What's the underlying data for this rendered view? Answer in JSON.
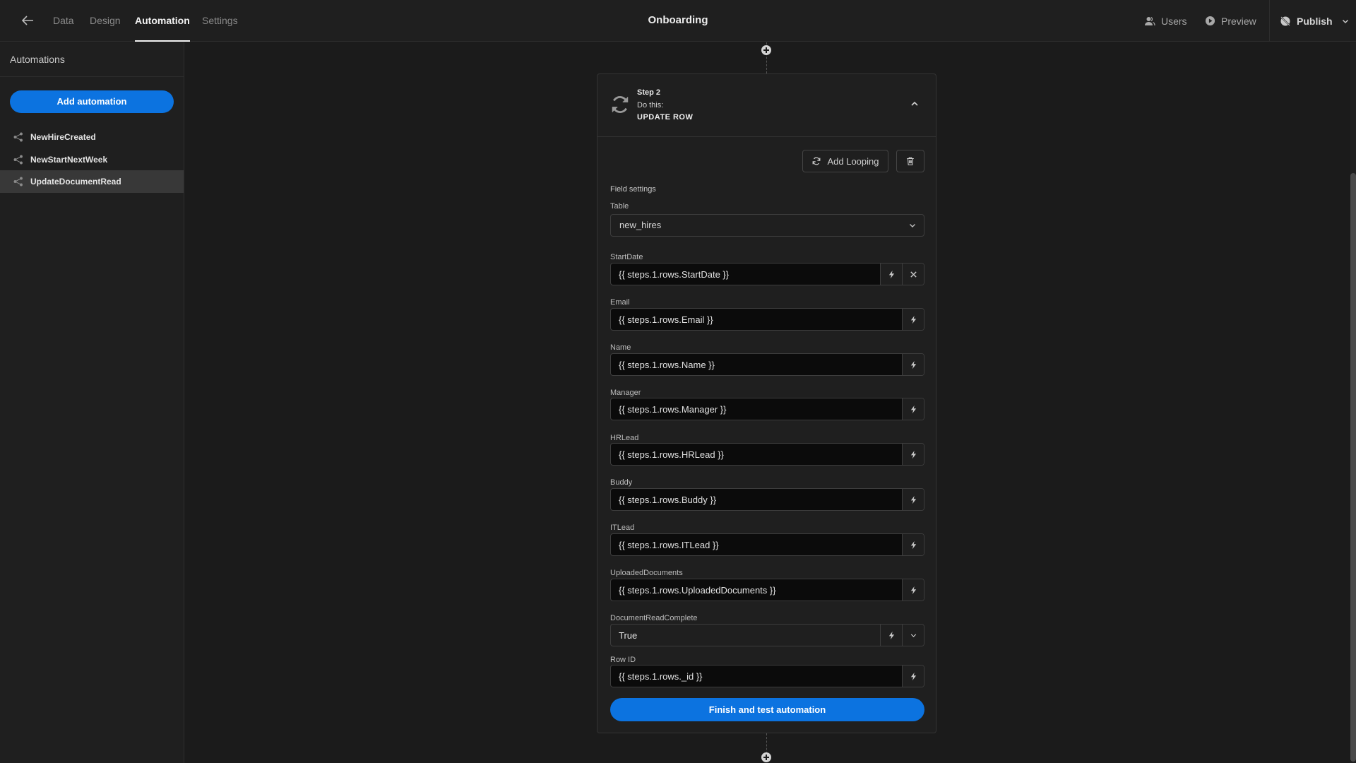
{
  "topbar": {
    "tabs": [
      {
        "label": "Data",
        "active": false
      },
      {
        "label": "Design",
        "active": false
      },
      {
        "label": "Automation",
        "active": true
      },
      {
        "label": "Settings",
        "active": false
      }
    ],
    "title": "Onboarding",
    "users_label": "Users",
    "preview_label": "Preview",
    "publish_label": "Publish"
  },
  "sidebar": {
    "title": "Automations",
    "add_button": "Add automation",
    "items": [
      {
        "label": "NewHireCreated",
        "selected": false
      },
      {
        "label": "NewStartNextWeek",
        "selected": false
      },
      {
        "label": "UpdateDocumentRead",
        "selected": true
      }
    ]
  },
  "step": {
    "number_label": "Step 2",
    "do_label": "Do this:",
    "action_label": "UPDATE ROW",
    "add_looping_label": "Add Looping",
    "field_settings_label": "Field settings",
    "table": {
      "label": "Table",
      "value": "new_hires"
    },
    "fields": [
      {
        "label": "StartDate",
        "value": "{{ steps.1.rows.StartDate }}",
        "clearable": true,
        "dropdown": false
      },
      {
        "label": "Email",
        "value": "{{ steps.1.rows.Email }}",
        "clearable": false,
        "dropdown": false
      },
      {
        "label": "Name",
        "value": "{{ steps.1.rows.Name }}",
        "clearable": false,
        "dropdown": false
      },
      {
        "label": "Manager",
        "value": "{{ steps.1.rows.Manager }}",
        "clearable": false,
        "dropdown": false
      },
      {
        "label": "HRLead",
        "value": "{{ steps.1.rows.HRLead }}",
        "clearable": false,
        "dropdown": false
      },
      {
        "label": "Buddy",
        "value": "{{ steps.1.rows.Buddy }}",
        "clearable": false,
        "dropdown": false
      },
      {
        "label": "ITLead",
        "value": "{{ steps.1.rows.ITLead }}",
        "clearable": false,
        "dropdown": false
      },
      {
        "label": "UploadedDocuments",
        "value": "{{ steps.1.rows.UploadedDocuments }}",
        "clearable": false,
        "dropdown": false
      },
      {
        "label": "DocumentReadComplete",
        "value": "True",
        "clearable": false,
        "dropdown": true
      },
      {
        "label": "Row ID",
        "value": "{{ steps.1.rows._id }}",
        "clearable": false,
        "dropdown": false
      }
    ],
    "finish_label": "Finish and test automation"
  },
  "colors": {
    "accent": "#0c73e0",
    "background": "#1b1b1b",
    "panel": "#1f1f1f",
    "input_bg": "#0b0b0b"
  }
}
